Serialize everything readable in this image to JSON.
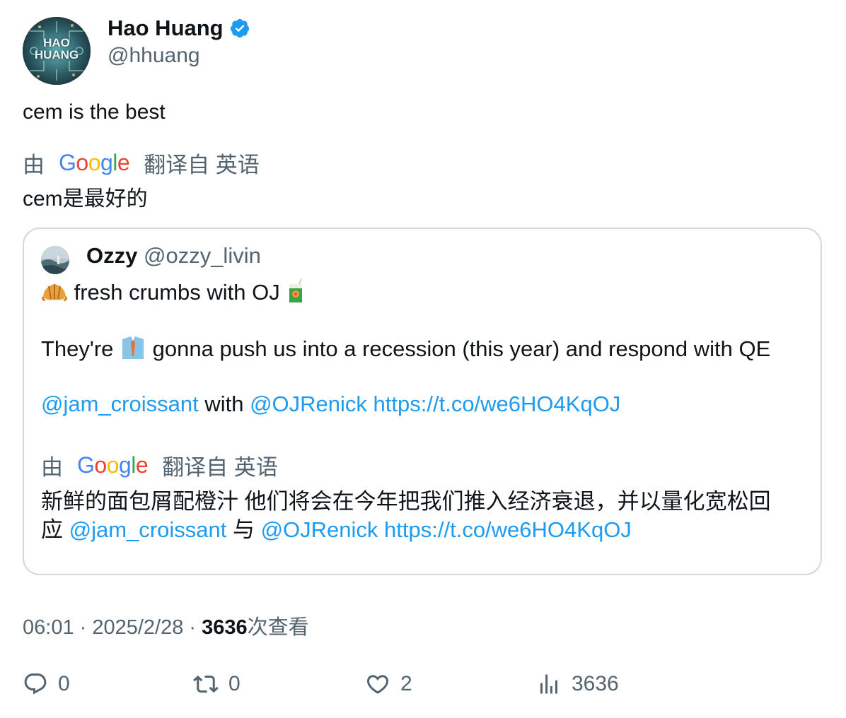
{
  "author": {
    "name": "Hao Huang",
    "handle": "@hhuang",
    "avatar_text_line1": "HAO",
    "avatar_text_line2": "HUANG"
  },
  "tweet": {
    "text": "cem is the best",
    "translation_prefix": "由",
    "translation_provider": "Google",
    "translation_suffix": "翻译自 英语",
    "translated_text": "cem是最好的"
  },
  "quote": {
    "name": "Ozzy",
    "handle": "@ozzy_livin",
    "line1_text": " fresh crumbs with OJ ",
    "line2_pre": "They're ",
    "line2_post": " gonna push us into a recession (this year) and respond with QE",
    "mention1": "@jam_croissant",
    "with_word": " with ",
    "mention2": "@OJRenick",
    "url": "https://t.co/we6HO4KqOJ",
    "translation_prefix": "由",
    "translation_provider": "Google",
    "translation_suffix": "翻译自 英语",
    "translated_line1": "新鲜的面包屑配橙汁 他们将会在今年把我们推入经济衰退，并以量化宽松回",
    "translated_line2_pre": "应 ",
    "translated_mention1": "@jam_croissant",
    "translated_with": " 与 ",
    "translated_mention2": "@OJRenick",
    "translated_url": "https://t.co/we6HO4KqOJ"
  },
  "meta": {
    "time": "06:01",
    "sep1": " · ",
    "date": "2025/2/28",
    "sep2": " · ",
    "views": "3636",
    "views_label": "次查看"
  },
  "actions": {
    "replies": "0",
    "retweets": "0",
    "likes": "2",
    "views": "3636"
  },
  "colors": {
    "link": "#1d9bf0",
    "secondary": "#536471",
    "verified": "#1d9bf0",
    "border": "#cfd9de"
  },
  "icons": {
    "reply": "reply-icon",
    "retweet": "retweet-icon",
    "like": "heart-icon",
    "views": "views-icon"
  }
}
